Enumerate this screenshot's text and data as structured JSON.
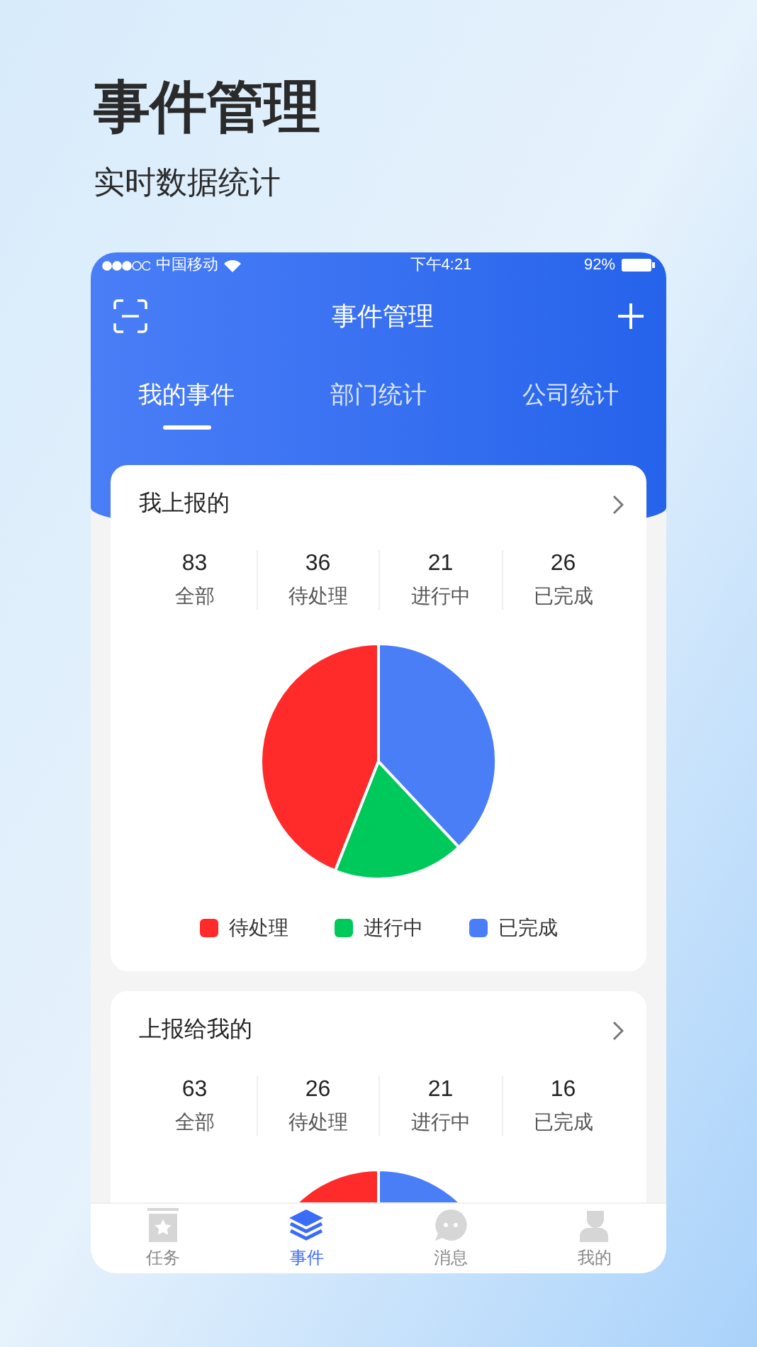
{
  "headline": "事件管理",
  "subtitle": "实时数据统计",
  "status_bar": {
    "carrier": "中国移动",
    "time": "下午4:21",
    "battery": "92%"
  },
  "header": {
    "title": "事件管理"
  },
  "tabs": [
    {
      "label": "我的事件",
      "selected": true
    },
    {
      "label": "部门统计",
      "selected": false
    },
    {
      "label": "公司统计",
      "selected": false
    }
  ],
  "cards": [
    {
      "title": "我上报的",
      "stats": [
        {
          "value": "83",
          "label": "全部"
        },
        {
          "value": "36",
          "label": "待处理"
        },
        {
          "value": "21",
          "label": "进行中"
        },
        {
          "value": "26",
          "label": "已完成"
        }
      ],
      "legend": [
        {
          "label": "待处理",
          "color": "#ff2a2a"
        },
        {
          "label": "进行中",
          "color": "#00c95c"
        },
        {
          "label": "已完成",
          "color": "#4a7ef7"
        }
      ]
    },
    {
      "title": "上报给我的",
      "stats": [
        {
          "value": "63",
          "label": "全部"
        },
        {
          "value": "26",
          "label": "待处理"
        },
        {
          "value": "21",
          "label": "进行中"
        },
        {
          "value": "16",
          "label": "已完成"
        }
      ]
    }
  ],
  "bottom_nav": [
    {
      "label": "任务",
      "kind": "task",
      "selected": false
    },
    {
      "label": "事件",
      "kind": "layers",
      "selected": true
    },
    {
      "label": "消息",
      "kind": "chat",
      "selected": false
    },
    {
      "label": "我的",
      "kind": "person",
      "selected": false
    }
  ]
}
